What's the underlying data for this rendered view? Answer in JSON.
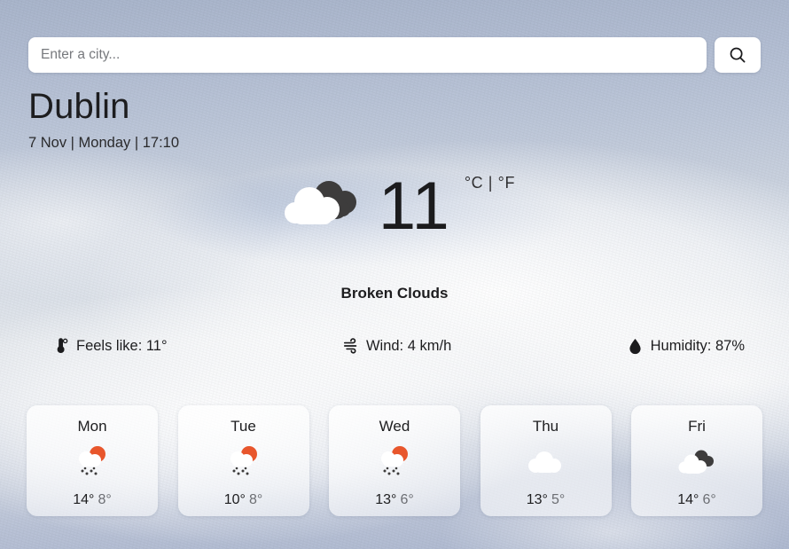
{
  "search": {
    "placeholder": "Enter a city...",
    "value": "",
    "button_icon": "search-icon"
  },
  "location": {
    "city": "Dublin",
    "datetime": "7 Nov | Monday | 17:10"
  },
  "current": {
    "temperature": "11",
    "units_toggle": "°C | °F",
    "unit_celsius": "°C",
    "unit_fahrenheit": "°F",
    "description": "Broken Clouds",
    "icon": "broken-clouds-icon"
  },
  "stats": [
    {
      "icon": "thermometer-icon",
      "label": "Feels like: 11°"
    },
    {
      "icon": "wind-icon",
      "label": "Wind: 4 km/h"
    },
    {
      "icon": "humidity-droplet-icon",
      "label": "Humidity: 87%"
    }
  ],
  "forecast": [
    {
      "day": "Mon",
      "icon": "sun-cloud-rain-icon",
      "high": "14°",
      "low": "8°"
    },
    {
      "day": "Tue",
      "icon": "sun-cloud-rain-icon",
      "high": "10°",
      "low": "8°"
    },
    {
      "day": "Wed",
      "icon": "sun-cloud-rain-icon",
      "high": "13°",
      "low": "6°"
    },
    {
      "day": "Thu",
      "icon": "cloud-icon",
      "high": "13°",
      "low": "5°"
    },
    {
      "day": "Fri",
      "icon": "broken-clouds-icon",
      "high": "14°",
      "low": "6°"
    }
  ],
  "colors": {
    "sun": "#e8562c",
    "dark_cloud": "#3d3c3c",
    "white_cloud": "#ffffff",
    "card_bg": "#ffffff",
    "text": "#1d1d1f"
  }
}
